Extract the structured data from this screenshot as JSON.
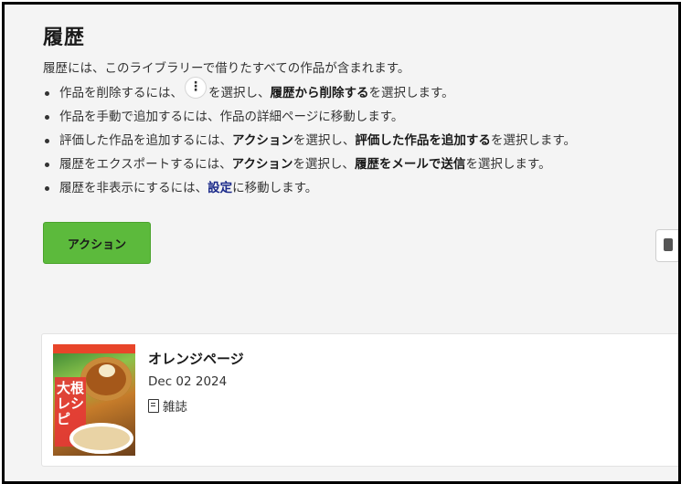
{
  "header": {
    "title": "履歴",
    "description": "履歴には、このライブラリーで借りたすべての作品が含まれます。"
  },
  "instructions": {
    "item1": {
      "pre": "作品を削除するには、",
      "icon": "more-vertical-icon",
      "mid": "を選択し、",
      "bold": "履歴から削除する",
      "post": "を選択します。"
    },
    "item2": {
      "text": "作品を手動で追加するには、作品の詳細ページに移動します。"
    },
    "item3": {
      "pre": "評価した作品を追加するには、",
      "bold1": "アクション",
      "mid": "を選択し、",
      "bold2": "評価した作品を追加する",
      "post": "を選択します。"
    },
    "item4": {
      "pre": "履歴をエクスポートするには、",
      "bold1": "アクション",
      "mid": "を選択し、",
      "bold2": "履歴をメールで送信",
      "post": "を選択します。"
    },
    "item5": {
      "pre": "履歴を非表示にするには、",
      "link": "設定",
      "post": "に移動します。"
    }
  },
  "toolbar": {
    "action_label": "アクション",
    "accent_color": "#5cba3c"
  },
  "history_items": [
    {
      "title": "オレンジページ",
      "date": "Dec 02 2024",
      "type_icon": "document-icon",
      "type_label": "雑誌",
      "cover_text": "大根レシピ"
    }
  ]
}
